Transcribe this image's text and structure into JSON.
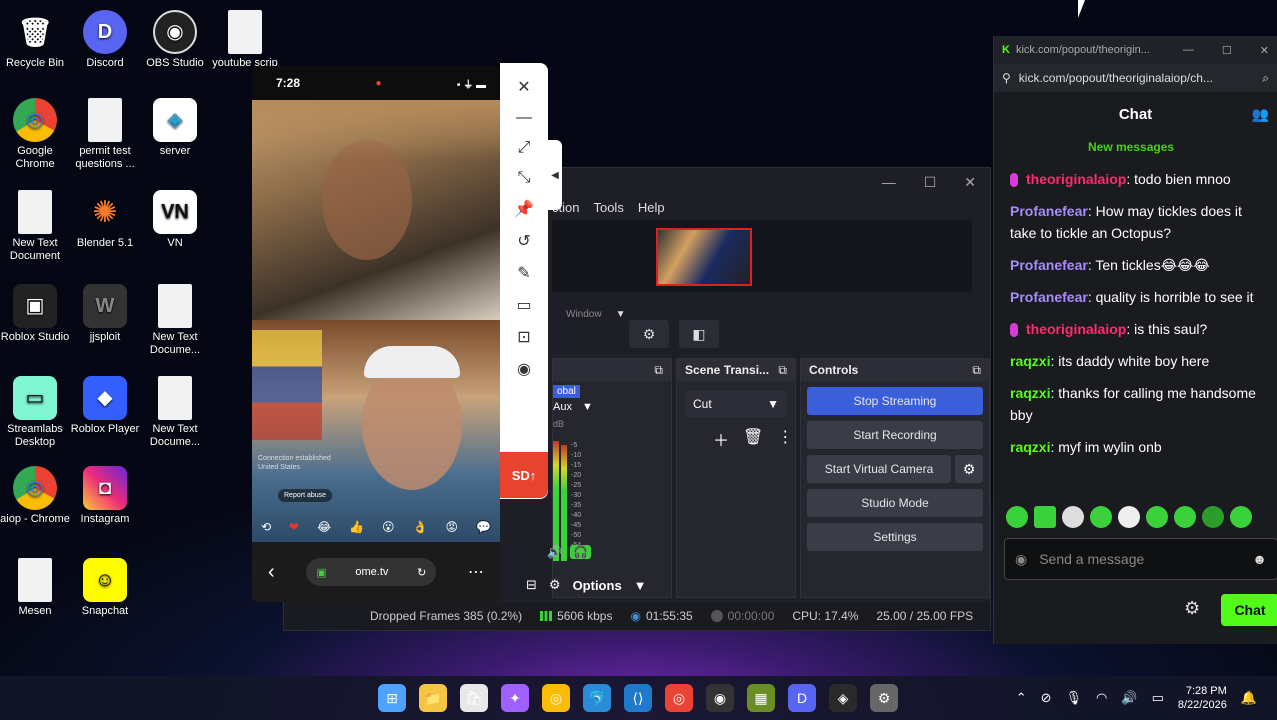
{
  "desktop": {
    "icons": [
      {
        "label": "Recycle Bin",
        "glyph": "🗑"
      },
      {
        "label": "Discord",
        "glyph": "D"
      },
      {
        "label": "OBS Studio",
        "glyph": "◉"
      },
      {
        "label": "youtube scrip",
        "glyph": ""
      },
      {
        "label": "Google Chrome",
        "glyph": "◎"
      },
      {
        "label": "permit test questions ...",
        "glyph": ""
      },
      {
        "label": "server",
        "glyph": "◈"
      },
      {
        "label": "New Text Document",
        "glyph": ""
      },
      {
        "label": "Blender 5.1",
        "glyph": "✺"
      },
      {
        "label": "VN",
        "glyph": "VN"
      },
      {
        "label": "Roblox Studio",
        "glyph": "▣"
      },
      {
        "label": "jjsploit",
        "glyph": "W"
      },
      {
        "label": "New Text Docume...",
        "glyph": ""
      },
      {
        "label": "Streamlabs Desktop",
        "glyph": "▭"
      },
      {
        "label": "Roblox Player",
        "glyph": "◆"
      },
      {
        "label": "New Text Docume...",
        "glyph": ""
      },
      {
        "label": "aiop - Chrome",
        "glyph": "◎"
      },
      {
        "label": "Instagram",
        "glyph": "◘"
      },
      {
        "label": "Mesen",
        "glyph": ""
      },
      {
        "label": "Snapchat",
        "glyph": "☺"
      }
    ]
  },
  "phone": {
    "time": "7:28",
    "signal_icons": "• ⏚ ▬",
    "connection_note_line1": "Connection established",
    "connection_note_line2": "United States",
    "report_button": "Report abuse",
    "reactions": [
      "⟲",
      "❤",
      "😂",
      "👍",
      "😮",
      "👌",
      "😡",
      "💬"
    ],
    "url": "ome.tv",
    "back_glyph": "‹",
    "reload_glyph": "↻",
    "more_glyph": "⋯"
  },
  "side_toolbar": {
    "buttons": [
      "✕",
      "—",
      "⤢",
      "⤡",
      "📌",
      "↺",
      "✎",
      "▭",
      "⊡",
      "◉"
    ],
    "sd_label": "SD↑",
    "collapse_glyph": "◀"
  },
  "obs": {
    "window_controls": [
      "—",
      "☐",
      "✕"
    ],
    "menu": [
      "ction",
      "Tools",
      "Help"
    ],
    "source_label": "Window",
    "scene_transitions": {
      "title": "Scene Transi...",
      "selected": "Cut"
    },
    "controls": {
      "title": "Controls",
      "stop_streaming": "Stop Streaming",
      "start_recording": "Start Recording",
      "start_virtual_camera": "Start Virtual Camera",
      "studio_mode": "Studio Mode",
      "settings": "Settings"
    },
    "mixer": {
      "global_label": "obal",
      "aux_label": "Aux",
      "db_label": "dB",
      "scale": [
        "-5",
        "-10",
        "-15",
        "-20",
        "-25",
        "-30",
        "-35",
        "-40",
        "-45",
        "-50",
        "-54",
        "-60"
      ]
    },
    "options_label": "Options",
    "status": {
      "dropped_frames": "Dropped Frames 385 (0.2%)",
      "bitrate": "5606 kbps",
      "stream_time": "01:55:35",
      "rec_time": "00:00:00",
      "cpu": "CPU: 17.4%",
      "fps": "25.00 / 25.00 FPS"
    }
  },
  "chat": {
    "tab_title": "kick.com/popout/theorigin...",
    "url": "kick.com/popout/theoriginalaiop/ch...",
    "header": "Chat",
    "new_messages": "New messages",
    "messages": [
      {
        "user": "theoriginalaiop",
        "text": ": todo bien mnoo",
        "color": "#ff2a6d",
        "badge": true
      },
      {
        "user": "Profanefear",
        "text": ": How may tickles does it take to tickle an Octopus?",
        "color": "#a78bfa",
        "badge": false
      },
      {
        "user": "Profanefear",
        "text": ": Ten tickles😂😂😂",
        "color": "#a78bfa",
        "badge": false
      },
      {
        "user": "Profanefear",
        "text": ": quality is horrible to see it",
        "color": "#a78bfa",
        "badge": false
      },
      {
        "user": "theoriginalaiop",
        "text": ": is this saul?",
        "color": "#ff2a6d",
        "badge": true
      },
      {
        "user": "raqzxi",
        "text": ": its daddy white boy here",
        "color": "#53fc18",
        "badge": false
      },
      {
        "user": "raqzxi",
        "text": ": thanks for calling me handsome bby",
        "color": "#53fc18",
        "badge": false
      },
      {
        "user": "raqzxi",
        "text": ": myf im wylin onb",
        "color": "#53fc18",
        "badge": false
      }
    ],
    "input_placeholder": "Send a message",
    "send_label": "Chat"
  },
  "taskbar": {
    "apps": [
      "⊞",
      "📁",
      "🛍",
      "✦",
      "◎",
      "🐬",
      "⟨⟩",
      "◎",
      "◉",
      "▦",
      "D",
      "◈",
      "⚙"
    ],
    "time": "7:28 PM",
    "date": "8/22/2026"
  },
  "colors": {
    "kick_green": "#53fc18",
    "obs_blue": "#3b5fd9",
    "sd_red": "#e8432e"
  }
}
